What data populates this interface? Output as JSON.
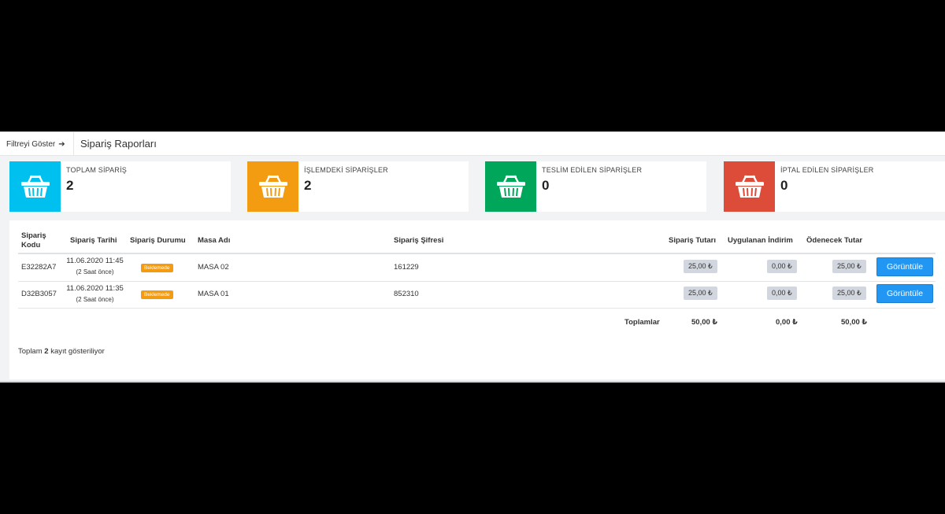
{
  "header": {
    "filter_label": "Filtreyi Göster",
    "filter_arrow": "➔",
    "title": "Sipariş Raporları"
  },
  "cards": [
    {
      "label": "TOPLAM SİPARİŞ",
      "count": "2",
      "color": "#00c0ef",
      "icon": "basket-icon"
    },
    {
      "label": "İŞLEMDEKİ SİPARİŞLER",
      "count": "2",
      "color": "#f39c12",
      "icon": "basket-icon"
    },
    {
      "label": "TESLİM EDİLEN SİPARİŞLER",
      "count": "0",
      "color": "#00a65a",
      "icon": "basket-icon"
    },
    {
      "label": "İPTAL EDİLEN SİPARİŞLER",
      "count": "0",
      "color": "#dd4b39",
      "icon": "basket-icon"
    }
  ],
  "table": {
    "columns": {
      "code_line1": "Sipariş",
      "code_line2": "Kodu",
      "date": "Sipariş Tarihi",
      "status": "Sipariş Durumu",
      "table_name": "Masa Adı",
      "password": "Sipariş Şifresi",
      "amount": "Sipariş Tutarı",
      "discount": "Uygulanan İndirim",
      "payable": "Ödenecek Tutar"
    },
    "rows": [
      {
        "code": "E32282A7",
        "date": "11.06.2020 11:45",
        "ago": "(2 Saat önce)",
        "status": "Beklemede",
        "table_name": "MASA 02",
        "password": "161229",
        "amount": "25,00 ₺",
        "discount": "0,00 ₺",
        "payable": "25,00 ₺",
        "action": "Görüntüle"
      },
      {
        "code": "D32B3057",
        "date": "11.06.2020 11:35",
        "ago": "(2 Saat önce)",
        "status": "Beklemede",
        "table_name": "MASA 01",
        "password": "852310",
        "amount": "25,00 ₺",
        "discount": "0,00 ₺",
        "payable": "25,00 ₺",
        "action": "Görüntüle"
      }
    ],
    "totals": {
      "label": "Toplamlar",
      "amount": "50,00 ₺",
      "discount": "0,00 ₺",
      "payable": "50,00 ₺"
    },
    "footer": {
      "prefix": "Toplam",
      "count": "2",
      "suffix": "kayıt gösteriliyor"
    }
  },
  "colors": {
    "accent_blue": "#2196f3",
    "status_pending": "#f39c12"
  }
}
